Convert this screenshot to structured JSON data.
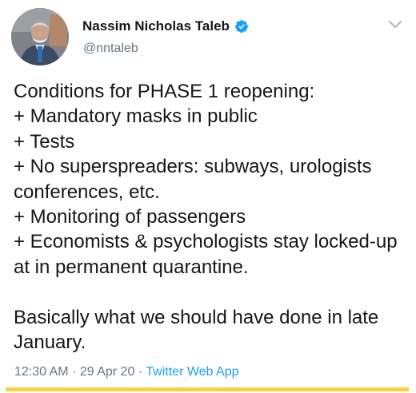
{
  "author": {
    "display_name": "Nassim Nicholas Taleb",
    "handle": "@nntaleb",
    "verified": true
  },
  "tweet": {
    "text": "Conditions for PHASE 1 reopening:\n+ Mandatory masks in public\n+ Tests\n+ No superspreaders: subways, urologists conferences, etc.\n+ Monitoring of passengers\n+ Economists & psychologists stay locked-up at in permanent quarantine.\n\nBasically what we should have done in late January.",
    "time": "12:30 AM",
    "separator1": "·",
    "date": "29 Apr 20",
    "separator2": "·",
    "source": "Twitter Web App"
  },
  "icons": {
    "verified": "verified-badge-icon",
    "caret": "chevron-down-icon"
  },
  "colors": {
    "text": "#14171a",
    "secondary": "#657786",
    "link": "#1da1f2",
    "verified": "#1da1f2",
    "accent_bar": "#f7d23e"
  }
}
